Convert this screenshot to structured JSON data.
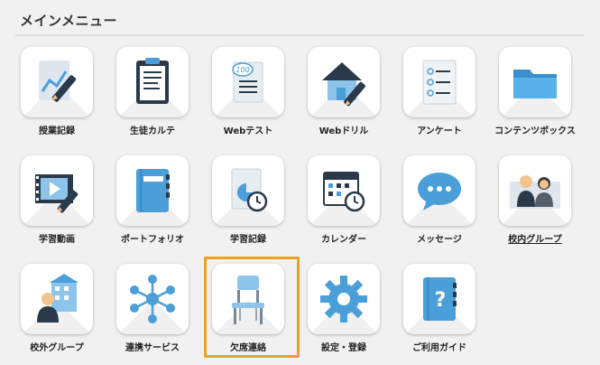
{
  "menu": {
    "title": "メインメニュー",
    "items": [
      {
        "label": "授業記録"
      },
      {
        "label": "生徒カルテ"
      },
      {
        "label": "Webテスト"
      },
      {
        "label": "Webドリル"
      },
      {
        "label": "アンケート"
      },
      {
        "label": "コンテンツボックス"
      },
      {
        "label": "学習動画"
      },
      {
        "label": "ポートフォリオ"
      },
      {
        "label": "学習記録"
      },
      {
        "label": "カレンダー"
      },
      {
        "label": "メッセージ"
      },
      {
        "label": "校内グループ"
      },
      {
        "label": "校外グループ"
      },
      {
        "label": "連携サービス"
      },
      {
        "label": "欠席連絡"
      },
      {
        "label": "設定・登録"
      },
      {
        "label": "ご利用ガイド"
      }
    ],
    "selected": "欠席連絡"
  },
  "colors": {
    "accent_highlight": "#f0a020",
    "icon_blue": "#4a9fd8",
    "icon_dark": "#2b3a4a"
  }
}
